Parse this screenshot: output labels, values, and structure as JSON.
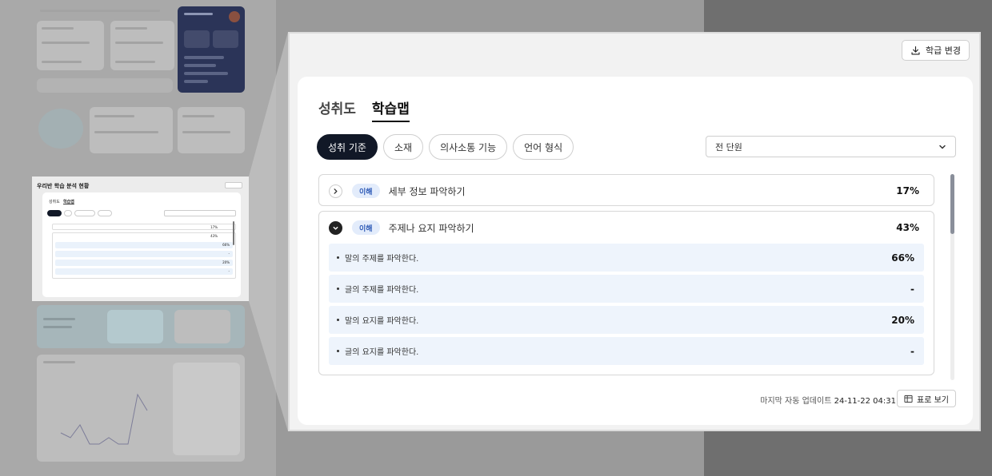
{
  "thumbnail": {
    "section_title": "우리반 학습 분석 현황",
    "tabs": [
      "성취도",
      "학습맵"
    ]
  },
  "panel": {
    "change_button": "학급 변경",
    "tabs": [
      {
        "label": "성취도",
        "active": false
      },
      {
        "label": "학습맵",
        "active": true
      }
    ],
    "filters": [
      {
        "label": "성취 기준",
        "active": true
      },
      {
        "label": "소재",
        "active": false
      },
      {
        "label": "의사소통 기능",
        "active": false
      },
      {
        "label": "언어 형식",
        "active": false
      }
    ],
    "unit_select": {
      "value": "전 단원"
    },
    "rows": [
      {
        "badge": "이해",
        "label": "세부 정보 파악하기",
        "percent": "17%",
        "expanded": false,
        "items": []
      },
      {
        "badge": "이해",
        "label": "주제나 요지 파악하기",
        "percent": "43%",
        "expanded": true,
        "items": [
          {
            "label": "말의 주제를 파악한다.",
            "value": "66%"
          },
          {
            "label": "글의 주제를 파악한다.",
            "value": "-"
          },
          {
            "label": "말의 요지를 파악한다.",
            "value": "20%"
          },
          {
            "label": "글의 요지를 파악한다.",
            "value": "-"
          }
        ]
      }
    ],
    "footer": {
      "update_label": "마지막 자동 업데이트",
      "update_time": "24-11-22 04:31",
      "table_button": "표로 보기"
    }
  },
  "colors": {
    "accent_dark": "#111827",
    "badge_bg": "#e3ecfb",
    "badge_text": "#2f5bb7",
    "sub_row_bg": "#eef4fc"
  },
  "icons": [
    "download-icon",
    "chevron-down-icon",
    "chevron-right-icon",
    "table-icon"
  ]
}
